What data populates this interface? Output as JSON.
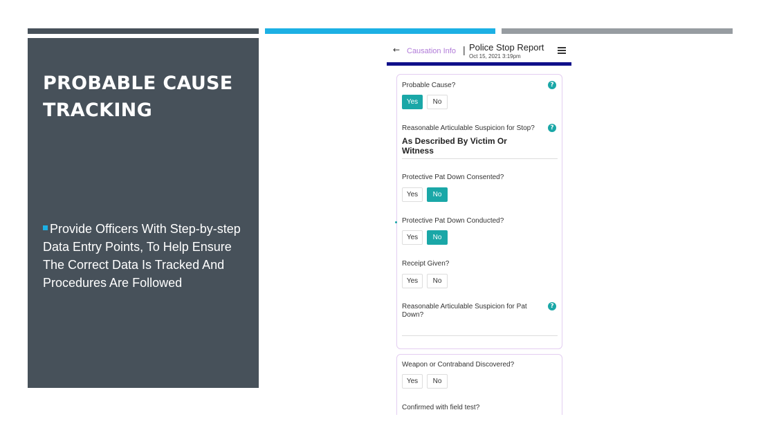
{
  "slide": {
    "title_line1": "PROBABLE CAUSE",
    "title_line2": "TRACKING",
    "bullet": "Provide Officers With Step-by-step Data Entry Points, To Help Ensure The Correct Data Is Tracked And Procedures Are Followed"
  },
  "app": {
    "back_icon": "back-arrow-icon",
    "back_glyph": "←",
    "breadcrumb": "Causation Info",
    "separator": "|",
    "title": "Police Stop Report",
    "date": "Oct 15, 2021 3:19pm",
    "menu_icon": "hamburger-menu-icon",
    "help_glyph": "?"
  },
  "colors": {
    "panel": "#47515a",
    "accent_blue": "#1cb0e4",
    "gray_bar": "#979ca1",
    "teal": "#1aa7a7",
    "header_rule": "#10108a",
    "breadcrumb": "#b07ad8"
  },
  "form": {
    "card1": {
      "probable_cause": {
        "label": "Probable Cause?",
        "yes": "Yes",
        "no": "No",
        "selected": "Yes"
      },
      "ras_stop": {
        "label": "Reasonable Articulable Suspicion for Stop?",
        "value": "As Described By Victim Or Witness"
      },
      "pat_down_consented": {
        "label": "Protective Pat Down Consented?",
        "yes": "Yes",
        "no": "No",
        "selected": "No"
      },
      "pat_down_conducted": {
        "label": "Protective Pat Down Conducted?",
        "yes": "Yes",
        "no": "No",
        "selected": "No"
      },
      "receipt_given": {
        "label": "Receipt Given?",
        "yes": "Yes",
        "no": "No",
        "selected": ""
      },
      "ras_pat_down": {
        "label": "Reasonable Articulable Suspicion for Pat Down?",
        "value": ""
      }
    },
    "card2": {
      "weapon_discovered": {
        "label": "Weapon or Contraband Discovered?",
        "yes": "Yes",
        "no": "No",
        "selected": ""
      },
      "field_test": {
        "label": "Confirmed with field test?"
      }
    }
  }
}
